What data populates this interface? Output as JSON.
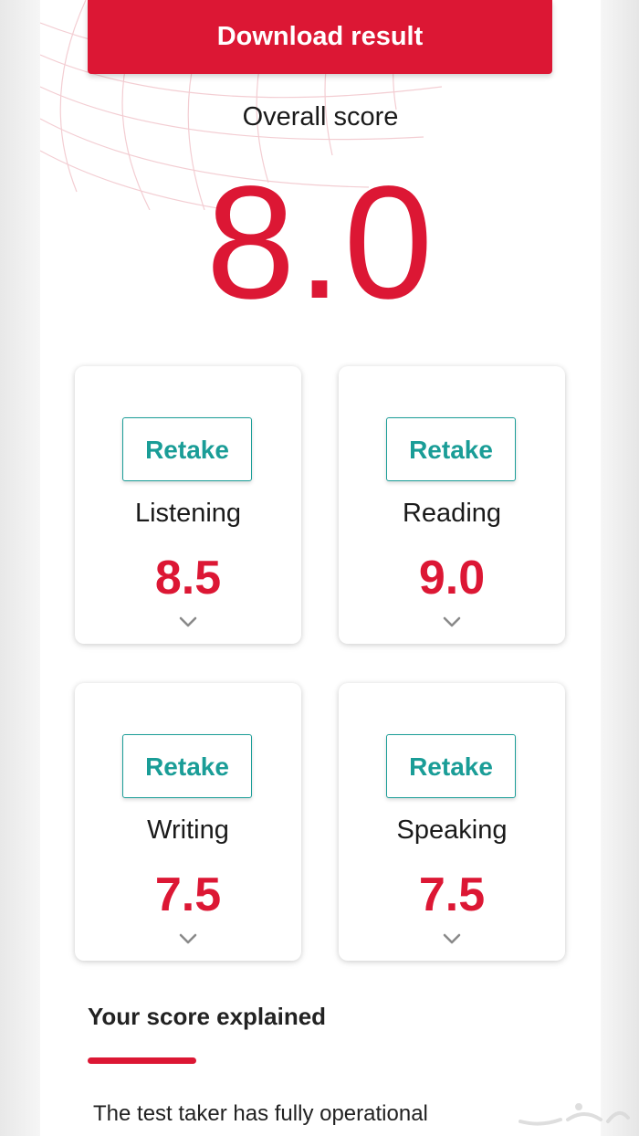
{
  "actions": {
    "download_label": "Download result"
  },
  "overall": {
    "label": "Overall score",
    "score": "8.0"
  },
  "skills": [
    {
      "name": "Listening",
      "score": "8.5",
      "retake_label": "Retake"
    },
    {
      "name": "Reading",
      "score": "9.0",
      "retake_label": "Retake"
    },
    {
      "name": "Writing",
      "score": "7.5",
      "retake_label": "Retake"
    },
    {
      "name": "Speaking",
      "score": "7.5",
      "retake_label": "Retake"
    }
  ],
  "explained": {
    "title": "Your score explained",
    "text": "The test taker has fully operational"
  },
  "colors": {
    "brand_red": "#dc1734",
    "teal": "#1a9d97",
    "text": "#1a1a1a",
    "chevron": "#8a8a8a"
  },
  "icons": {
    "expand": "chevron-down-icon"
  }
}
